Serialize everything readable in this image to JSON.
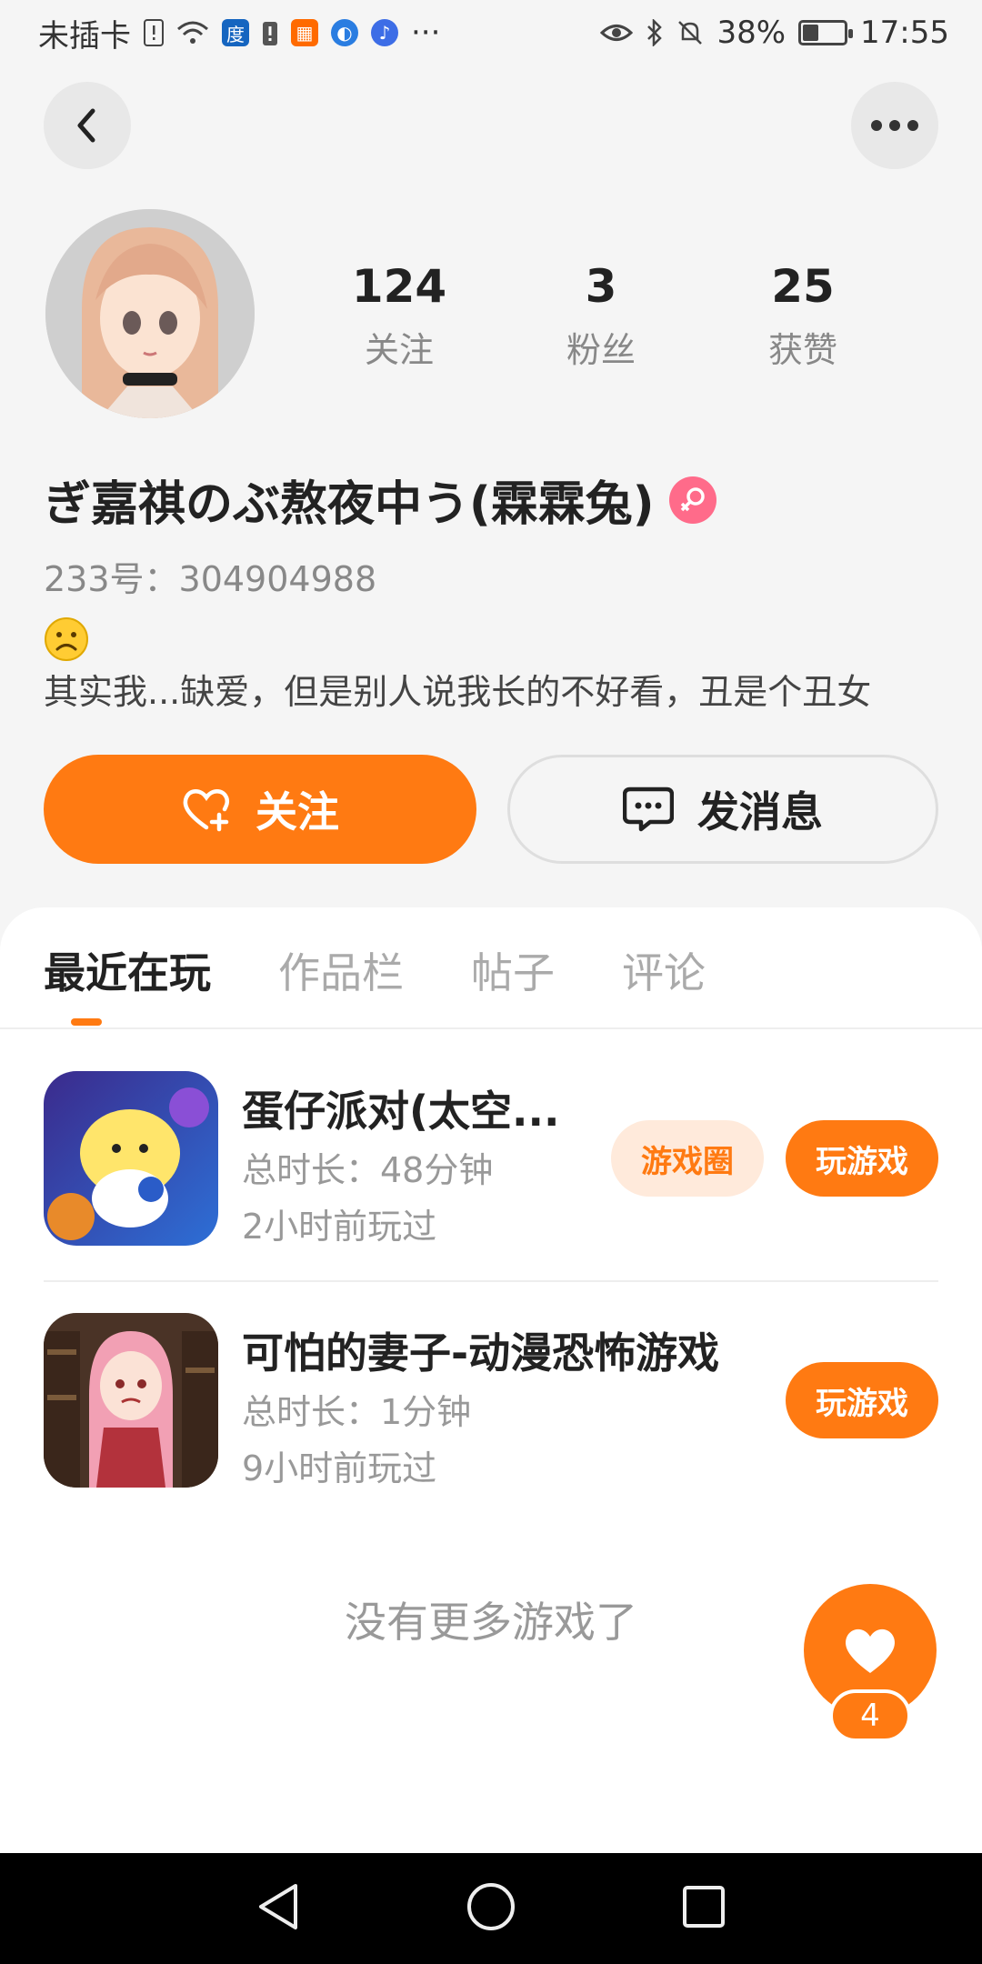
{
  "status_bar": {
    "carrier": "未插卡",
    "battery": "38%",
    "battery_level": 0.38,
    "time": "17:55",
    "more": "···"
  },
  "profile": {
    "stats": [
      {
        "value": "124",
        "label": "关注"
      },
      {
        "value": "3",
        "label": "粉丝"
      },
      {
        "value": "25",
        "label": "获赞"
      }
    ],
    "name": "ぎ嘉祺のぶ熬夜中う(霖霖兔)",
    "id_line": "233号：304904988",
    "bio": "其实我...缺爱，但是别人说我长的不好看，丑是个丑女"
  },
  "actions": {
    "follow_label": "关注",
    "message_label": "发消息"
  },
  "tabs": [
    "最近在玩",
    "作品栏",
    "帖子",
    "评论"
  ],
  "games": [
    {
      "name": "蛋仔派对(太空...",
      "duration": "总时长：48分钟",
      "last_played": "2小时前玩过",
      "circle_label": "游戏圈",
      "play_label": "玩游戏"
    },
    {
      "name": "可怕的妻子-动漫恐怖游戏",
      "duration": "总时长：1分钟",
      "last_played": "9小时前玩过",
      "play_label": "玩游戏"
    }
  ],
  "footer_note": "没有更多游戏了",
  "like_count": "4",
  "colors": {
    "accent": "#ff7a12",
    "accent_light": "#ffeadb",
    "gender": "#ff6b8a"
  }
}
